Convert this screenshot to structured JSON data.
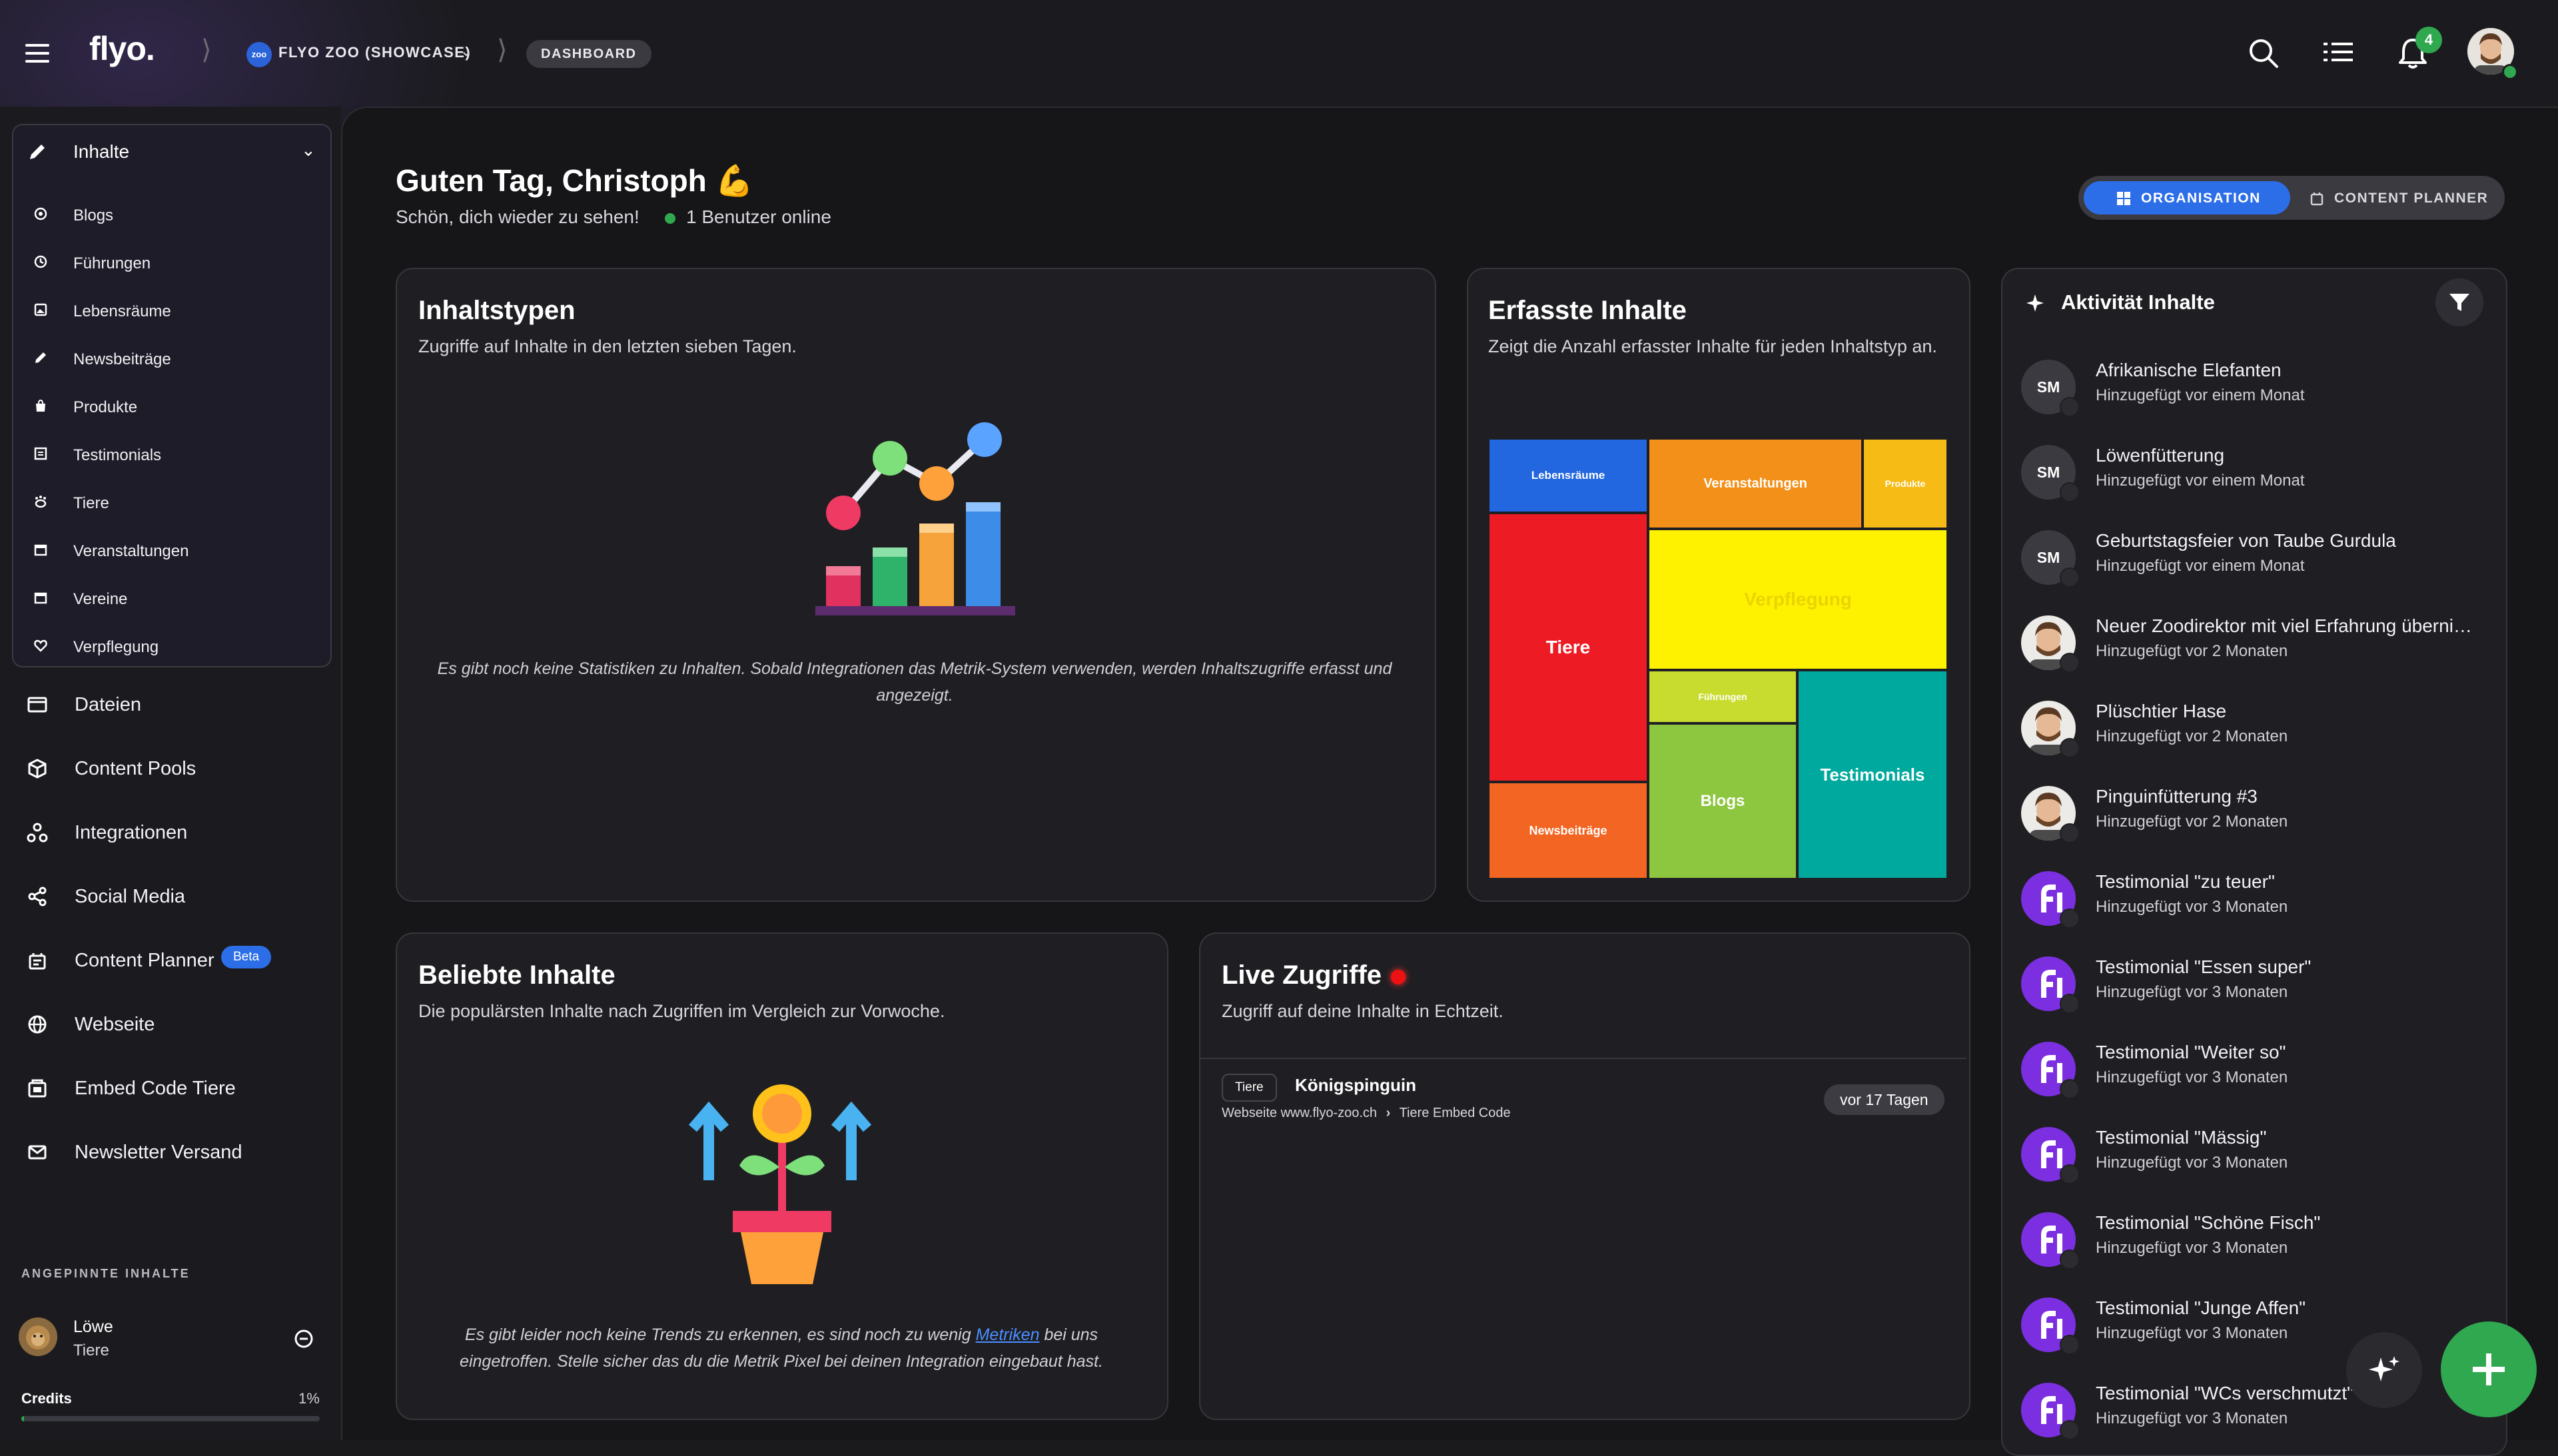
{
  "topbar": {
    "logo": "flyo.",
    "org_avatar": "zoo",
    "org_name": "FLYO ZOO (SHOWCASE)",
    "crumb": "DASHBOARD",
    "notification_count": "4",
    "icons": [
      "menu-icon",
      "search-icon",
      "list-icon",
      "bell-icon",
      "user-avatar"
    ]
  },
  "sidebar": {
    "group_label": "Inhalte",
    "sub_items": [
      {
        "label": "Blogs",
        "icon": "target-icon"
      },
      {
        "label": "Führungen",
        "icon": "clock-icon"
      },
      {
        "label": "Lebensräume",
        "icon": "gallery-icon"
      },
      {
        "label": "Newsbeiträge",
        "icon": "pen-icon"
      },
      {
        "label": "Produkte",
        "icon": "bag-icon"
      },
      {
        "label": "Testimonials",
        "icon": "box-icon"
      },
      {
        "label": "Tiere",
        "icon": "paw-icon"
      },
      {
        "label": "Veranstaltungen",
        "icon": "calendar-icon"
      },
      {
        "label": "Vereine",
        "icon": "calendar-icon"
      },
      {
        "label": "Verpflegung",
        "icon": "heart-icon"
      }
    ],
    "items": [
      {
        "label": "Dateien",
        "icon": "folder-icon"
      },
      {
        "label": "Content Pools",
        "icon": "cube-icon"
      },
      {
        "label": "Integrationen",
        "icon": "nodes-icon"
      },
      {
        "label": "Social Media",
        "icon": "share-icon"
      },
      {
        "label": "Content Planner",
        "icon": "planner-icon"
      },
      {
        "label": "Webseite",
        "icon": "globe-icon"
      },
      {
        "label": "Embed Code Tiere",
        "icon": "embed-icon"
      },
      {
        "label": "Newsletter Versand",
        "icon": "mail-icon"
      }
    ],
    "beta_label": "Beta",
    "pinned_title": "ANGEPINNTE INHALTE",
    "pinned": {
      "name": "Löwe",
      "type": "Tiere"
    },
    "credits_label": "Credits",
    "credits_value": "1%",
    "credits_fraction": 0.01
  },
  "header": {
    "greeting": "Guten Tag, Christoph 💪",
    "subtitle": "Schön, dich wieder zu sehen!",
    "online": "1 Benutzer online",
    "toggle": {
      "left": "ORGANISATION",
      "right": "CONTENT PLANNER"
    }
  },
  "cards": {
    "types": {
      "title": "Inhaltstypen",
      "subtitle": "Zugriffe auf Inhalte in den letzten sieben Tagen.",
      "empty": "Es gibt noch keine Statistiken zu Inhalten. Sobald Integrationen das Metrik-System verwenden, werden Inhaltszugriffe erfasst und angezeigt."
    },
    "captured": {
      "title": "Erfasste Inhalte",
      "subtitle": "Zeigt die Anzahl erfasster Inhalte für jeden Inhaltstyp an."
    },
    "popular": {
      "title": "Beliebte Inhalte",
      "subtitle": "Die populärsten Inhalte nach Zugriffen im Vergleich zur Vorwoche.",
      "empty_pre": "Es gibt leider noch keine Trends zu erkennen, es sind noch zu wenig",
      "empty_link": "Metriken",
      "empty_post": "bei uns eingetroffen. Stelle sicher das du die Metrik Pixel bei deinen Integration eingebaut hast."
    },
    "live": {
      "title": "Live Zugriffe",
      "subtitle": "Zugriff auf deine Inhalte in Echtzeit.",
      "entry": {
        "tag": "Tiere",
        "title": "Königspinguin",
        "path_from": "Webseite www.flyo-zoo.ch",
        "path_to": "Tiere Embed Code",
        "time": "vor 17 Tagen"
      }
    }
  },
  "treemap": [
    {
      "label": "Lebensräume",
      "color": "#2266e0"
    },
    {
      "label": "Veranstaltungen",
      "color": "#f39019"
    },
    {
      "label": "Produkte",
      "color": "#f7bb15"
    },
    {
      "label": "Tiere",
      "color": "#ed1c24"
    },
    {
      "label": "Verpflegung",
      "color": "#fff200"
    },
    {
      "label": "Führungen",
      "color": "#c8dc30"
    },
    {
      "label": "Blogs",
      "color": "#8dc63f"
    },
    {
      "label": "Testimonials",
      "color": "#00a99d"
    },
    {
      "label": "Newsbeiträge",
      "color": "#f26522"
    }
  ],
  "activity": {
    "title": "Aktivität Inhalte",
    "items": [
      {
        "avatar": "SM",
        "kind": "initials",
        "title": "Afrikanische Elefanten",
        "time": "Hinzugefügt vor einem Monat"
      },
      {
        "avatar": "SM",
        "kind": "initials",
        "title": "Löwenfütterung",
        "time": "Hinzugefügt vor einem Monat"
      },
      {
        "avatar": "SM",
        "kind": "initials",
        "title": "Geburtstagsfeier von Taube Gurdula",
        "time": "Hinzugefügt vor einem Monat"
      },
      {
        "avatar": "",
        "kind": "photo",
        "title": "Neuer Zoodirektor mit viel Erfahrung überni…",
        "time": "Hinzugefügt vor 2 Monaten"
      },
      {
        "avatar": "",
        "kind": "photo",
        "title": "Plüschtier Hase",
        "time": "Hinzugefügt vor 2 Monaten"
      },
      {
        "avatar": "",
        "kind": "photo",
        "title": "Pinguinfütterung #3",
        "time": "Hinzugefügt vor 2 Monaten"
      },
      {
        "avatar": "fl",
        "kind": "logo",
        "title": "Testimonial \"zu teuer\"",
        "time": "Hinzugefügt vor 3 Monaten"
      },
      {
        "avatar": "fl",
        "kind": "logo",
        "title": "Testimonial \"Essen super\"",
        "time": "Hinzugefügt vor 3 Monaten"
      },
      {
        "avatar": "fl",
        "kind": "logo",
        "title": "Testimonial \"Weiter so\"",
        "time": "Hinzugefügt vor 3 Monaten"
      },
      {
        "avatar": "fl",
        "kind": "logo",
        "title": "Testimonial \"Mässig\"",
        "time": "Hinzugefügt vor 3 Monaten"
      },
      {
        "avatar": "fl",
        "kind": "logo",
        "title": "Testimonial \"Schöne Fisch\"",
        "time": "Hinzugefügt vor 3 Monaten"
      },
      {
        "avatar": "fl",
        "kind": "logo",
        "title": "Testimonial \"Junge Affen\"",
        "time": "Hinzugefügt vor 3 Monaten"
      },
      {
        "avatar": "fl",
        "kind": "logo",
        "title": "Testimonial \"WCs verschmutzt\"",
        "time": "Hinzugefügt vor 3 Monaten"
      }
    ]
  },
  "colors": {
    "accent": "#2c6ee8",
    "success": "#2fa84f",
    "live": "#ee1111"
  }
}
